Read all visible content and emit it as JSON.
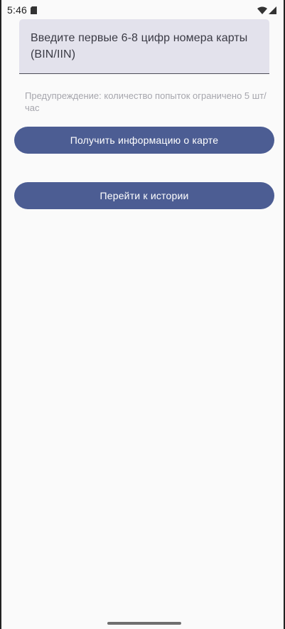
{
  "status_bar": {
    "time": "5:46",
    "icons": [
      "sd-card-icon",
      "wifi-icon",
      "signal-icon"
    ]
  },
  "input": {
    "placeholder": "Введите первые 6-8 цифр номера карты (BIN/IIN)"
  },
  "warning": "Предупреждение: количество попыток ограничено 5 шт/час",
  "buttons": {
    "get_info": "Получить информацию о карте",
    "history": "Перейти к истории"
  },
  "colors": {
    "button": "#4c5d93",
    "input_bg": "#e3e2ec",
    "warning_text": "#a6a6ad"
  }
}
